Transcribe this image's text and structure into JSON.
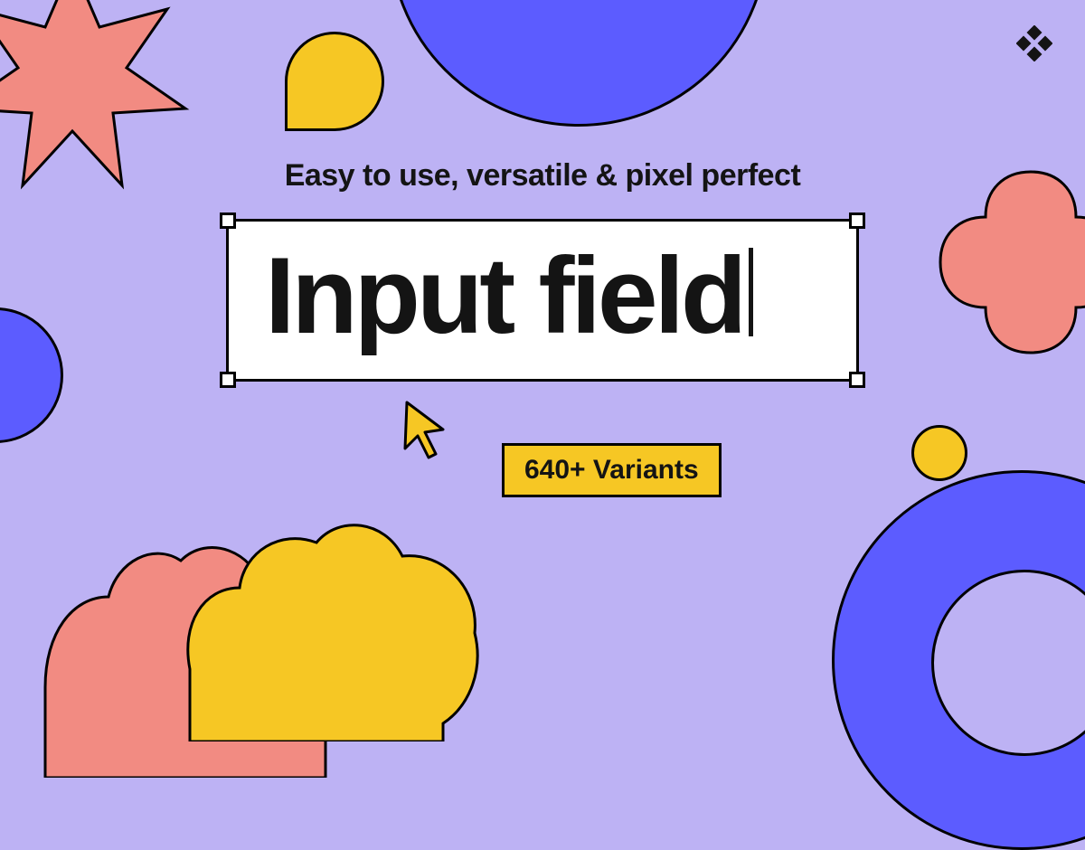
{
  "tagline": "Easy to use, versatile & pixel perfect",
  "title": "Input field",
  "badge": "640+ Variants",
  "icons": {
    "diamond": "diamond-logo-icon",
    "cursor": "cursor-arrow-icon"
  },
  "colors": {
    "background": "#BDB2F4",
    "blue": "#5C5CFF",
    "pink": "#F28B82",
    "yellow": "#F6C724",
    "black": "#141414",
    "white": "#FFFFFF"
  }
}
